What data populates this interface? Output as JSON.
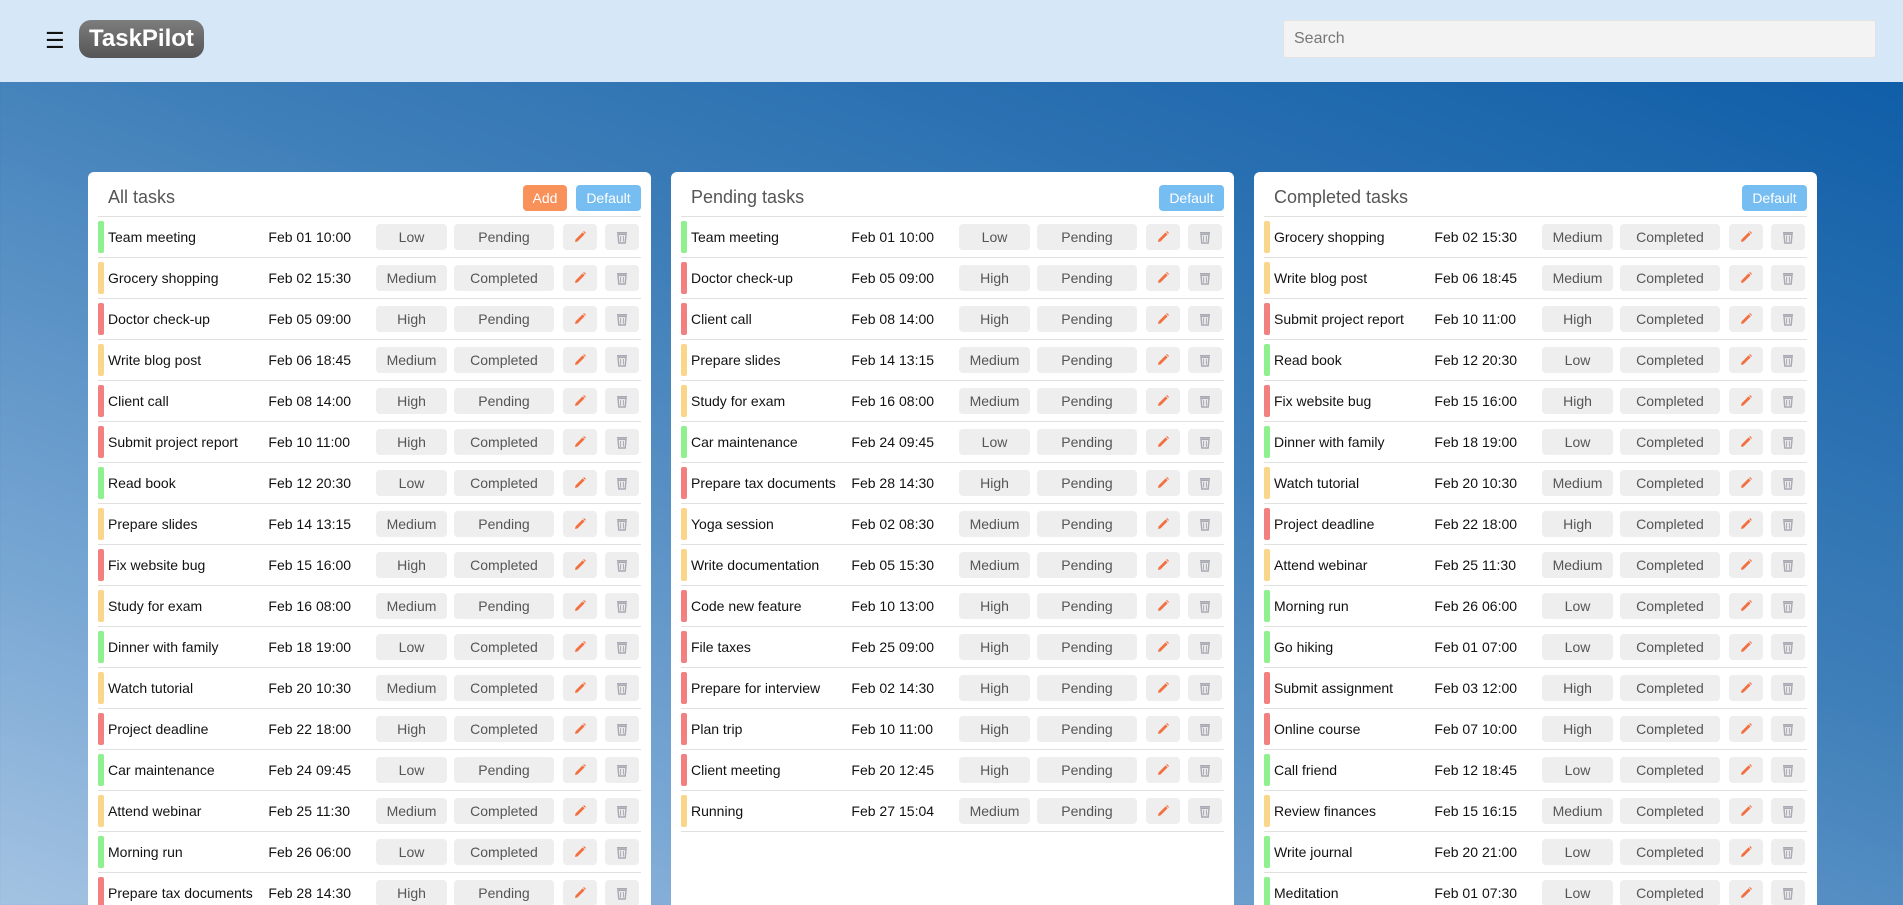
{
  "app": {
    "title": "TaskPilot",
    "menu_icon": "menu-icon",
    "search_placeholder": "Search"
  },
  "colors": {
    "low": "#8ef08e",
    "medium": "#fad68a",
    "high": "#f28080",
    "add": "#f8915a",
    "default": "#76bdf2"
  },
  "panels": [
    {
      "title": "All tasks",
      "add_label": "Add",
      "default_label": "Default",
      "tasks": [
        {
          "title": "Team meeting",
          "date": "Feb 01",
          "time": "10:00",
          "priority": "Low",
          "status": "Pending"
        },
        {
          "title": "Grocery shopping",
          "date": "Feb 02",
          "time": "15:30",
          "priority": "Medium",
          "status": "Completed"
        },
        {
          "title": "Doctor check-up",
          "date": "Feb 05",
          "time": "09:00",
          "priority": "High",
          "status": "Pending"
        },
        {
          "title": "Write blog post",
          "date": "Feb 06",
          "time": "18:45",
          "priority": "Medium",
          "status": "Completed"
        },
        {
          "title": "Client call",
          "date": "Feb 08",
          "time": "14:00",
          "priority": "High",
          "status": "Pending"
        },
        {
          "title": "Submit project report",
          "date": "Feb 10",
          "time": "11:00",
          "priority": "High",
          "status": "Completed"
        },
        {
          "title": "Read book",
          "date": "Feb 12",
          "time": "20:30",
          "priority": "Low",
          "status": "Completed"
        },
        {
          "title": "Prepare slides",
          "date": "Feb 14",
          "time": "13:15",
          "priority": "Medium",
          "status": "Pending"
        },
        {
          "title": "Fix website bug",
          "date": "Feb 15",
          "time": "16:00",
          "priority": "High",
          "status": "Completed"
        },
        {
          "title": "Study for exam",
          "date": "Feb 16",
          "time": "08:00",
          "priority": "Medium",
          "status": "Pending"
        },
        {
          "title": "Dinner with family",
          "date": "Feb 18",
          "time": "19:00",
          "priority": "Low",
          "status": "Completed"
        },
        {
          "title": "Watch tutorial",
          "date": "Feb 20",
          "time": "10:30",
          "priority": "Medium",
          "status": "Completed"
        },
        {
          "title": "Project deadline",
          "date": "Feb 22",
          "time": "18:00",
          "priority": "High",
          "status": "Completed"
        },
        {
          "title": "Car maintenance",
          "date": "Feb 24",
          "time": "09:45",
          "priority": "Low",
          "status": "Pending"
        },
        {
          "title": "Attend webinar",
          "date": "Feb 25",
          "time": "11:30",
          "priority": "Medium",
          "status": "Completed"
        },
        {
          "title": "Morning run",
          "date": "Feb 26",
          "time": "06:00",
          "priority": "Low",
          "status": "Completed"
        },
        {
          "title": "Prepare tax documents",
          "date": "Feb 28",
          "time": "14:30",
          "priority": "High",
          "status": "Pending"
        }
      ]
    },
    {
      "title": "Pending tasks",
      "default_label": "Default",
      "tasks": [
        {
          "title": "Team meeting",
          "date": "Feb 01",
          "time": "10:00",
          "priority": "Low",
          "status": "Pending"
        },
        {
          "title": "Doctor check-up",
          "date": "Feb 05",
          "time": "09:00",
          "priority": "High",
          "status": "Pending"
        },
        {
          "title": "Client call",
          "date": "Feb 08",
          "time": "14:00",
          "priority": "High",
          "status": "Pending"
        },
        {
          "title": "Prepare slides",
          "date": "Feb 14",
          "time": "13:15",
          "priority": "Medium",
          "status": "Pending"
        },
        {
          "title": "Study for exam",
          "date": "Feb 16",
          "time": "08:00",
          "priority": "Medium",
          "status": "Pending"
        },
        {
          "title": "Car maintenance",
          "date": "Feb 24",
          "time": "09:45",
          "priority": "Low",
          "status": "Pending"
        },
        {
          "title": "Prepare tax documents",
          "date": "Feb 28",
          "time": "14:30",
          "priority": "High",
          "status": "Pending"
        },
        {
          "title": "Yoga session",
          "date": "Feb 02",
          "time": "08:30",
          "priority": "Medium",
          "status": "Pending"
        },
        {
          "title": "Write documentation",
          "date": "Feb 05",
          "time": "15:30",
          "priority": "Medium",
          "status": "Pending"
        },
        {
          "title": "Code new feature",
          "date": "Feb 10",
          "time": "13:00",
          "priority": "High",
          "status": "Pending"
        },
        {
          "title": "File taxes",
          "date": "Feb 25",
          "time": "09:00",
          "priority": "High",
          "status": "Pending"
        },
        {
          "title": "Prepare for interview",
          "date": "Feb 02",
          "time": "14:30",
          "priority": "High",
          "status": "Pending"
        },
        {
          "title": "Plan trip",
          "date": "Feb 10",
          "time": "11:00",
          "priority": "High",
          "status": "Pending"
        },
        {
          "title": "Client meeting",
          "date": "Feb 20",
          "time": "12:45",
          "priority": "High",
          "status": "Pending"
        },
        {
          "title": "Running",
          "date": "Feb 27",
          "time": "15:04",
          "priority": "Medium",
          "status": "Pending"
        }
      ]
    },
    {
      "title": "Completed tasks",
      "default_label": "Default",
      "tasks": [
        {
          "title": "Grocery shopping",
          "date": "Feb 02",
          "time": "15:30",
          "priority": "Medium",
          "status": "Completed"
        },
        {
          "title": "Write blog post",
          "date": "Feb 06",
          "time": "18:45",
          "priority": "Medium",
          "status": "Completed"
        },
        {
          "title": "Submit project report",
          "date": "Feb 10",
          "time": "11:00",
          "priority": "High",
          "status": "Completed"
        },
        {
          "title": "Read book",
          "date": "Feb 12",
          "time": "20:30",
          "priority": "Low",
          "status": "Completed"
        },
        {
          "title": "Fix website bug",
          "date": "Feb 15",
          "time": "16:00",
          "priority": "High",
          "status": "Completed"
        },
        {
          "title": "Dinner with family",
          "date": "Feb 18",
          "time": "19:00",
          "priority": "Low",
          "status": "Completed"
        },
        {
          "title": "Watch tutorial",
          "date": "Feb 20",
          "time": "10:30",
          "priority": "Medium",
          "status": "Completed"
        },
        {
          "title": "Project deadline",
          "date": "Feb 22",
          "time": "18:00",
          "priority": "High",
          "status": "Completed"
        },
        {
          "title": "Attend webinar",
          "date": "Feb 25",
          "time": "11:30",
          "priority": "Medium",
          "status": "Completed"
        },
        {
          "title": "Morning run",
          "date": "Feb 26",
          "time": "06:00",
          "priority": "Low",
          "status": "Completed"
        },
        {
          "title": "Go hiking",
          "date": "Feb 01",
          "time": "07:00",
          "priority": "Low",
          "status": "Completed"
        },
        {
          "title": "Submit assignment",
          "date": "Feb 03",
          "time": "12:00",
          "priority": "High",
          "status": "Completed"
        },
        {
          "title": "Online course",
          "date": "Feb 07",
          "time": "10:00",
          "priority": "High",
          "status": "Completed"
        },
        {
          "title": "Call friend",
          "date": "Feb 12",
          "time": "18:45",
          "priority": "Low",
          "status": "Completed"
        },
        {
          "title": "Review finances",
          "date": "Feb 15",
          "time": "16:15",
          "priority": "Medium",
          "status": "Completed"
        },
        {
          "title": "Write journal",
          "date": "Feb 20",
          "time": "21:00",
          "priority": "Low",
          "status": "Completed"
        },
        {
          "title": "Meditation",
          "date": "Feb 01",
          "time": "07:30",
          "priority": "Low",
          "status": "Completed"
        }
      ]
    }
  ]
}
